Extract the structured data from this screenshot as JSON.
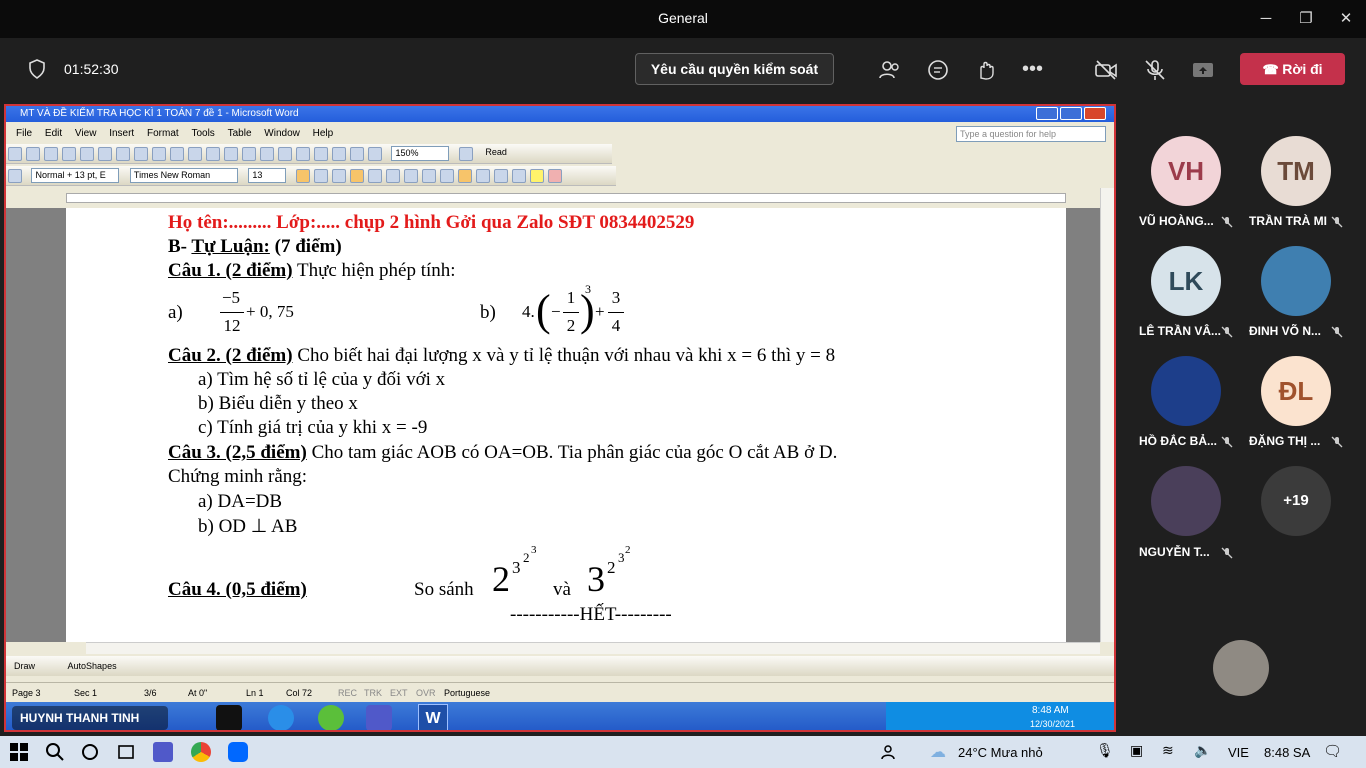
{
  "window": {
    "title": "General",
    "minimize": "─",
    "maximize": "❐",
    "close": "✕"
  },
  "call": {
    "timer": "01:52:30",
    "request_control": "Yêu cầu quyền kiểm soát",
    "leave": "Rời đi"
  },
  "word": {
    "title": "MT VÀ ĐỀ KIỂM TRA HỌC KÌ 1 TOÁN 7 đề 1 - Microsoft Word",
    "menu": [
      "File",
      "Edit",
      "View",
      "Insert",
      "Format",
      "Tools",
      "Table",
      "Window",
      "Help"
    ],
    "help_placeholder": "Type a question for help",
    "zoom": "150%",
    "read": "Read",
    "style": "Normal + 13 pt, E",
    "font": "Times New Roman",
    "size": "13",
    "draw": "Draw",
    "autoshapes": "AutoShapes",
    "status": {
      "page": "Page 3",
      "sec": "Sec 1",
      "pages": "3/6",
      "at": "At 0\"",
      "ln": "Ln 1",
      "col": "Col 72",
      "rec": "REC",
      "trk": "TRK",
      "ext": "EXT",
      "ovr": "OVR",
      "lang": "Portuguese"
    },
    "taskbar": {
      "presenter": "HUYNH THANH TINH",
      "time": "8:48 AM",
      "date": "12/30/2021"
    }
  },
  "doc": {
    "header": "Họ tên:......... Lớp:.....    chụp 2 hình Gởi qua Zalo SĐT 0834402529",
    "section": "B- ",
    "section_u": "Tự Luận:",
    "section_rest": " (7 điểm)",
    "q1_label": "Câu 1. (2 điểm)",
    "q1_text": " Thực hiện phép tính:",
    "q1a": "a)",
    "q1a_num": "−5",
    "q1a_den": "12",
    "q1a_rest": "+ 0, 75",
    "q1b": "b)",
    "q1b_pre": "4.",
    "q1b_in_num": "1",
    "q1b_in_den": "2",
    "q1b_exp": "3",
    "q1b_num": "3",
    "q1b_den": "4",
    "q2_label": "Câu 2. (2 điểm)",
    "q2_text": " Cho biết hai đại lượng x và y tỉ lệ thuận với nhau và khi x = 6 thì y = 8",
    "q2a": "a)  Tìm hệ số tỉ lệ của y đối với x",
    "q2b": "b)  Biểu diễn y theo x",
    "q2c": "c)  Tính giá trị của y khi x = -9",
    "q3_label": "Câu 3. (2,5 điểm)",
    "q3_text": " Cho tam giác AOB có OA=OB. Tia phân giác của góc O cắt AB ở D.",
    "q3_line2": "Chứng minh rằng:",
    "q3a": "a)  DA=DB",
    "q3b": "b)  OD ⊥  AB",
    "q4_label": "Câu 4. (0,5 điểm)",
    "q4_text": "So sánh",
    "q4_and": "và",
    "end": "-----------HẾT---------"
  },
  "participants": [
    {
      "initials": "VH",
      "name": "VŨ HOÀNG...",
      "color": "#f2d4d8",
      "text": "#9c3b4b"
    },
    {
      "initials": "TM",
      "name": "TRẦN TRÀ MI",
      "color": "#e8dcd4",
      "text": "#6b4a3a"
    },
    {
      "initials": "LK",
      "name": "LÊ TRẦN VÂ...",
      "color": "#d7e3ea",
      "text": "#2f4a5a"
    },
    {
      "initials": "",
      "name": "ĐINH VÕ N...",
      "color": "#3f7fb0",
      "text": "#fff"
    },
    {
      "initials": "",
      "name": "HỒ ĐẮC BẢ...",
      "color": "#1d3e8a",
      "text": "#fff"
    },
    {
      "initials": "ĐL",
      "name": "ĐẶNG THỊ ...",
      "color": "#fbe3cf",
      "text": "#a0522d"
    },
    {
      "initials": "",
      "name": "NGUYỄN T...",
      "color": "#4a3f5a",
      "text": "#fff"
    },
    {
      "initials": "+19",
      "name": "",
      "color": "#3b3b3b",
      "text": "#fff"
    }
  ],
  "win_taskbar": {
    "weather": "24°C  Mưa nhỏ",
    "lang": "VIE",
    "time": "8:48 SA"
  }
}
